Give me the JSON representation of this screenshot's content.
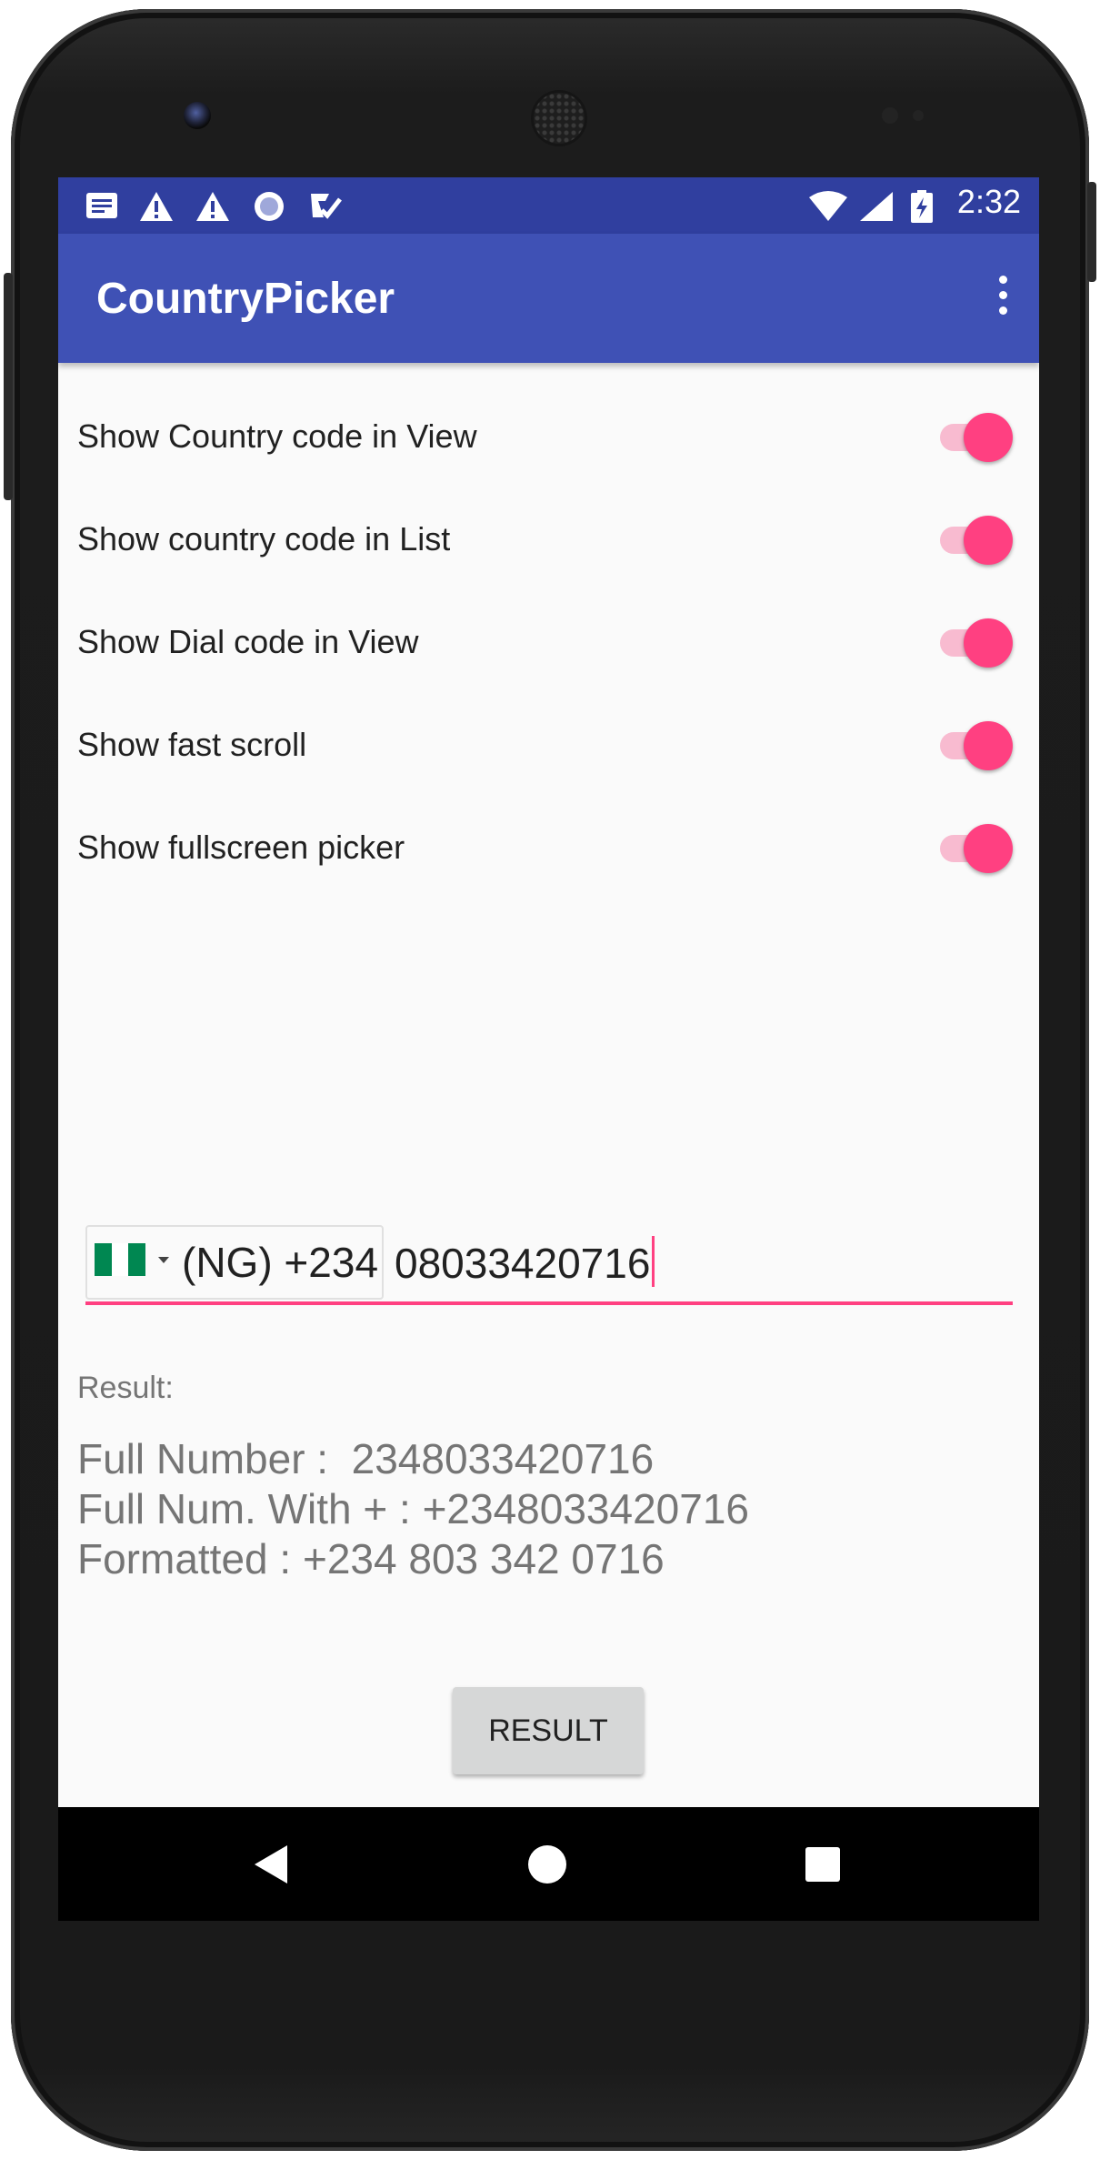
{
  "status_bar": {
    "time": "2:32",
    "notification_icons": [
      "notes-icon",
      "warning-icon",
      "warning-icon",
      "radio-icon",
      "task-check-icon"
    ],
    "system_icons": [
      "wifi-icon",
      "cell-signal-icon",
      "battery-charging-icon"
    ],
    "color": "#303f9f"
  },
  "app_bar": {
    "title": "CountryPicker",
    "menu_icon": "more-vert-icon",
    "color": "#3f51b5"
  },
  "settings": [
    {
      "label": "Show Country code in View",
      "checked": true
    },
    {
      "label": "Show country code in List",
      "checked": true
    },
    {
      "label": "Show Dial code in View",
      "checked": true
    },
    {
      "label": "Show fast scroll",
      "checked": true
    },
    {
      "label": "Show fullscreen picker",
      "checked": true
    }
  ],
  "accent_color": "#ff4081",
  "phone_field": {
    "country_flag": "nigeria-flag-icon",
    "country_text": "(NG) +234",
    "number": "08033420716"
  },
  "result": {
    "label": "Result:",
    "full_number": "Full Number :  2348033420716",
    "full_number_plus": "Full Num. With + : +2348033420716",
    "formatted": "Formatted : +234 803 342 0716"
  },
  "button": {
    "label": "RESULT"
  },
  "nav_bar": {
    "icons": [
      "back-icon",
      "home-icon",
      "recents-icon"
    ]
  }
}
